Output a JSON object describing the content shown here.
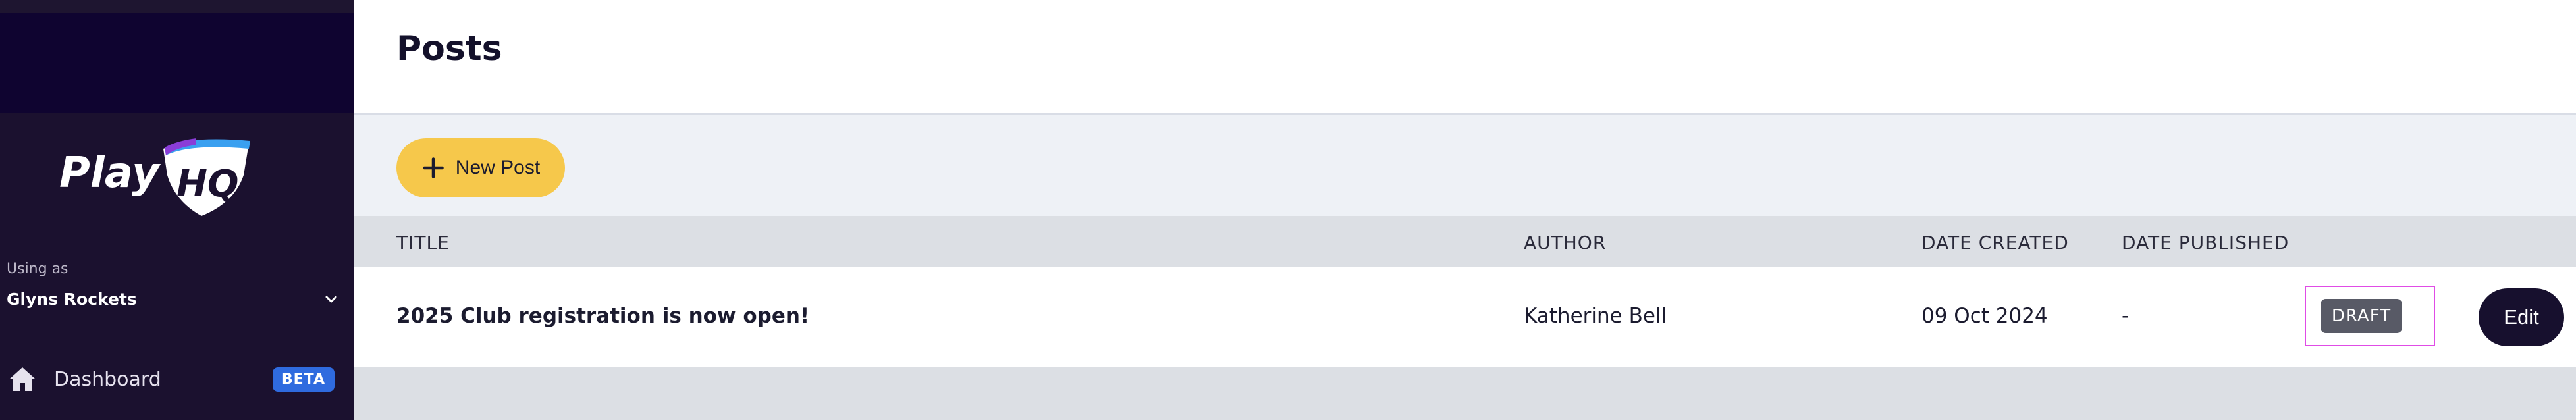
{
  "sidebar": {
    "logo_text": "PlayHQ",
    "using_as_label": "Using as",
    "org_name": "Glyns Rockets",
    "nav": [
      {
        "label": "Dashboard",
        "badge": "BETA",
        "icon": "home-icon"
      }
    ]
  },
  "header": {
    "title": "Posts"
  },
  "toolbar": {
    "new_post_label": "New Post",
    "icon": "plus-icon"
  },
  "table": {
    "columns": [
      "TITLE",
      "AUTHOR",
      "DATE CREATED",
      "DATE PUBLISHED"
    ],
    "rows": [
      {
        "title": "2025 Club registration is now open!",
        "author": "Katherine Bell",
        "date_created": "09 Oct 2024",
        "date_published": "-",
        "status": "DRAFT",
        "action": "Edit"
      }
    ]
  },
  "colors": {
    "sidebar_bg": "#1b112f",
    "accent_yellow": "#f6c84b",
    "beta_blue": "#2f6bdf",
    "dark_button": "#17102e"
  }
}
